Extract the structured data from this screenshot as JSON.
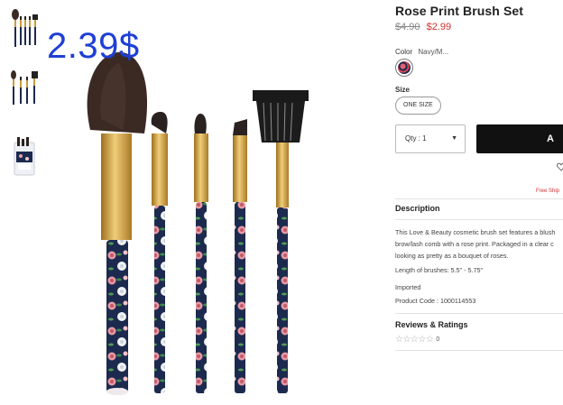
{
  "product": {
    "title": "Rose Print Brush Set",
    "price_old": "$4.90",
    "price_new": "$2.99",
    "overlay_price": "2.39$"
  },
  "color": {
    "label": "Color",
    "value": "Navy/M..."
  },
  "size": {
    "label": "Size",
    "option": "ONE SIZE"
  },
  "quantity": {
    "label": "Qty : 1",
    "caret": "▼"
  },
  "cart": {
    "button_label": "A"
  },
  "shipping": {
    "text": "Free Ship"
  },
  "description": {
    "heading": "Description",
    "lines": [
      "This Love & Beauty cosmetic brush set features a blush",
      "brow/lash comb with a rose print. Packaged in a clear c",
      "looking as pretty as a bouquet of roses."
    ],
    "length": "Length of brushes: 5.5\" - 5.75\"",
    "origin": "Imported",
    "product_code": "Product Code : 1000114553"
  },
  "reviews": {
    "heading": "Reviews & Ratings",
    "stars": "☆☆☆☆☆",
    "count": "0"
  },
  "icons": {
    "heart": "heart-icon",
    "star": "star-icon",
    "caret": "chevron-down-icon"
  },
  "colors": {
    "brand_black": "#111111",
    "sale_red": "#d0312d",
    "overlay_blue": "#1f3fd6",
    "handle_navy": "#1d2a4f",
    "ferrule_gold": "#c89b3c"
  }
}
